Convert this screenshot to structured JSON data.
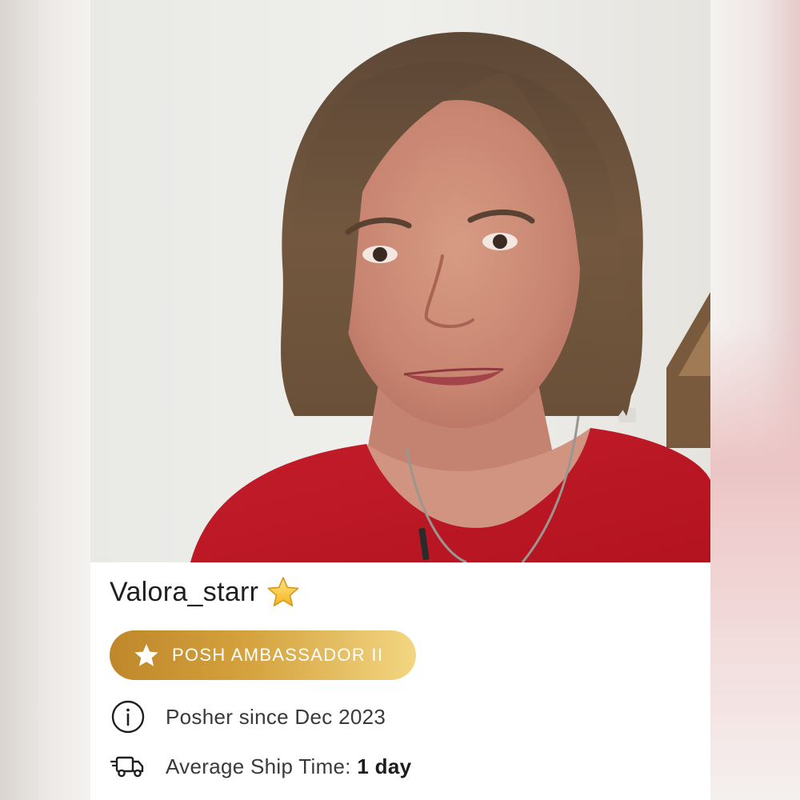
{
  "profile": {
    "username": "Valora_starr",
    "photo_alt": "Profile photo",
    "badge": {
      "label": "POSH AMBASSADOR II",
      "icon": "star-icon"
    },
    "posher_since": "Posher since Dec 2023",
    "ship_time_label": "Average Ship Time: ",
    "ship_time_value": "1 day",
    "icons": {
      "info": "info-icon",
      "truck": "truck-icon",
      "emoji": "star-emoji-icon"
    }
  },
  "colors": {
    "badge_gradient_start": "#bf872a",
    "badge_gradient_end": "#f3d682",
    "shirt": "#c8202e",
    "hair": "#6e5540"
  }
}
